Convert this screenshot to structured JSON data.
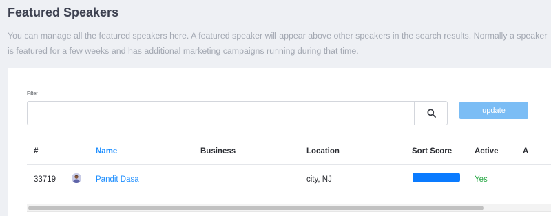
{
  "page": {
    "title": "Featured Speakers",
    "description": "You can manage all the featured speakers here. A featured speaker will appear above other speakers in the search results. Normally a speaker is featured for a few weeks and has additional marketing campaigns running during that time."
  },
  "filter": {
    "label": "Filter",
    "value": "",
    "placeholder": "",
    "search_icon": "search-icon",
    "update_label": "update"
  },
  "table": {
    "columns": [
      "#",
      "Name",
      "Business",
      "Location",
      "Sort Score",
      "Active",
      "A"
    ],
    "rows": [
      {
        "id": "33719",
        "avatar_icon": "avatar",
        "name": "Pandit Dasa",
        "business": "",
        "location": "city, NJ",
        "sort_score_fraction": 1.0,
        "active": "Yes"
      }
    ]
  },
  "colors": {
    "accent": "#1f8fff",
    "update_button": "#7bbdf5",
    "score_bar": "#0a7bff",
    "active_text": "#27a844"
  }
}
